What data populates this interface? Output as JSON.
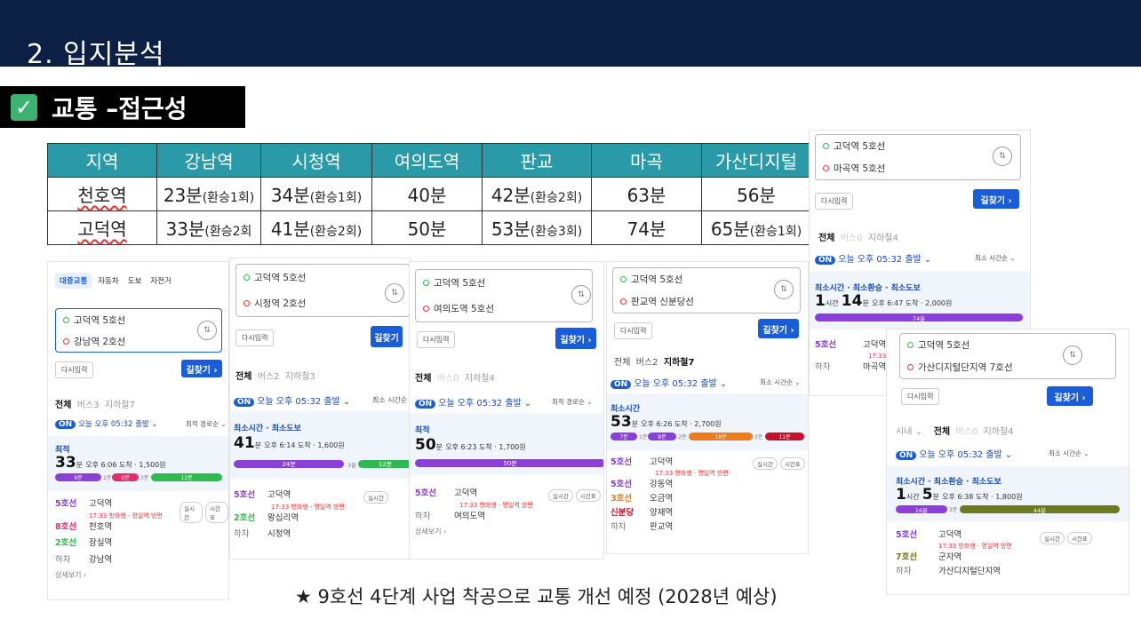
{
  "header": {
    "title": "2. 입지분석"
  },
  "section": {
    "title": "교통 –접근성"
  },
  "table": {
    "headers": [
      "지역",
      "강남역",
      "시청역",
      "여의도역",
      "판교",
      "마곡",
      "가산디지털"
    ],
    "rows": [
      {
        "area": "천호역",
        "cells": [
          [
            "23분",
            "(환승1회)"
          ],
          [
            "34분",
            "(환승1회)"
          ],
          [
            "40분",
            ""
          ],
          [
            "42분",
            "(환승2회)"
          ],
          [
            "63분",
            ""
          ],
          [
            "56분",
            ""
          ]
        ]
      },
      {
        "area": "고덕역",
        "cells": [
          [
            "33분",
            "(환승2회"
          ],
          [
            "41분",
            "(환승2회)"
          ],
          [
            "50분",
            ""
          ],
          [
            "53분",
            "(환승3회)"
          ],
          [
            "74분",
            ""
          ],
          [
            "65분",
            "(환승1회)"
          ]
        ]
      }
    ]
  },
  "shots": {
    "gangnam": {
      "modes": [
        "대중교통",
        "자동차",
        "도보",
        "자전거"
      ],
      "from": "고덕역 5호선",
      "to": "강남역 2호선",
      "reset": "다시입력",
      "search": "길찾기 ›",
      "tabs": [
        "전체",
        "버스3",
        "지하철7"
      ],
      "on_time": "오늘 오후 05:32 출발 ⌄",
      "sort": "최적 경로순 ⌄",
      "label": "최적",
      "time": "33",
      "time_unit": "분",
      "arrive": "오후 6:06 도착 · 1,500원",
      "segments": [
        "9분",
        "1분",
        "8분",
        "3분",
        "12분"
      ],
      "steps": [
        [
          "5호선",
          "고덕역"
        ],
        [
          "",
          "17:33 방화행 · 명일역 방면"
        ],
        [
          "8호선",
          "천호역"
        ],
        [
          "2호선",
          "잠실역"
        ],
        [
          "하차",
          "강남역"
        ]
      ],
      "more": "상세보기 ›"
    },
    "city": {
      "from": "고덕역 5호선",
      "to": "시청역 2호선",
      "reset": "다시입력",
      "search": "길찾기",
      "tabs": [
        "전체",
        "버스2",
        "지하철3"
      ],
      "on_time": "오늘 오후 05:32 출발 ⌄",
      "sort": "최소 시간순",
      "label": "최소시간 · 최소도보",
      "time": "41",
      "time_unit": "분",
      "arrive": "오후 6:14 도착 · 1,600원",
      "segments": [
        "24분",
        "3분",
        "12분"
      ],
      "steps": [
        [
          "5호선",
          "고덕역"
        ],
        [
          "",
          "17:33 방화행 · 명일역 방면"
        ],
        [
          "2호선",
          "왕십리역"
        ],
        [
          "하차",
          "시청역"
        ]
      ]
    },
    "yeouido": {
      "from": "고덕역 5호선",
      "to": "여의도역 5호선",
      "reset": "다시입력",
      "search": "길찾기 ›",
      "tabs": [
        "전체",
        "버스0",
        "지하철4"
      ],
      "on_time": "오늘 오후 05:32 출발 ⌄",
      "sort": "최적 경로순 ⌄",
      "label": "최적",
      "time": "50",
      "time_unit": "분",
      "arrive": "오후 6:23 도착 · 1,700원",
      "segments": [
        "50분"
      ],
      "steps": [
        [
          "5호선",
          "고덕역"
        ],
        [
          "",
          "17:33 방화행 · 명일역 방면"
        ],
        [
          "하차",
          "여의도역"
        ]
      ],
      "more": "상세보기 ›"
    },
    "pangyo": {
      "from": "고덕역 5호선",
      "to": "판교역 신분당선",
      "reset": "다시입력",
      "search": "길찾기 ›",
      "tabs": [
        "전체",
        "버스2",
        "지하철7"
      ],
      "on_time": "오늘 오후 05:32 출발 ⌄",
      "sort": "최소 시간순 ⌄",
      "label": "최소시간",
      "time": "53",
      "time_unit": "분",
      "arrive": "오후 6:26 도착 · 2,700원",
      "segments": [
        "7분",
        "1분",
        "8분",
        "2분",
        "19분",
        "3분",
        "11분"
      ],
      "steps": [
        [
          "5호선",
          "고덕역"
        ],
        [
          "",
          "17:33 방화행 · 명일역 방면"
        ],
        [
          "5호선",
          "강동역"
        ],
        [
          "3호선",
          "오금역"
        ],
        [
          "신분당",
          "양재역"
        ],
        [
          "하차",
          "판교역"
        ]
      ]
    },
    "magok": {
      "from": "고덕역 5호선",
      "to": "마곡역 5호선",
      "reset": "다시입력",
      "search": "길찾기 ›",
      "tabs": [
        "전체",
        "버스0",
        "지하철4"
      ],
      "on_time": "오늘 오후 05:32 출발 ⌄",
      "sort": "최소 시간순 ⌄",
      "label": "최소시간 · 최소환승 · 최소도보",
      "time": "1",
      "time_unit": "시간",
      "time2": "14",
      "time2_unit": "분",
      "arrive": "오후 6:47 도착 · 2,000원",
      "segments": [
        "74분"
      ],
      "steps": [
        [
          "5호선",
          "고덕역"
        ],
        [
          "",
          "17:33 방"
        ],
        [
          "하차",
          "마곡역"
        ]
      ]
    },
    "gasan": {
      "from": "고덕역 5호선",
      "to": "가산디지털단지역 7호선",
      "reset": "다시입력",
      "search": "길찾기 ›",
      "tabs": [
        "시내 ⌄",
        "전체",
        "버스0",
        "지하철4"
      ],
      "on_time": "오늘 오후 05:32 출발 ⌄",
      "sort": "최소 시간순 ⌄",
      "label": "최소시간 · 최소환승 · 최소도보",
      "time": "1",
      "time_unit": "시간",
      "time2": "5",
      "time2_unit": "분",
      "arrive": "오후 6:38 도착 · 1,800원",
      "segments": [
        "16분",
        "3분",
        "44분"
      ],
      "steps": [
        [
          "5호선",
          "고덕역"
        ],
        [
          "",
          "17:33 방화행 · 명일역 방면"
        ],
        [
          "7호선",
          "군자역"
        ],
        [
          "하차",
          "가산디지털단지역"
        ]
      ]
    },
    "realtime": "실시간",
    "timetable": "시간표"
  },
  "note": "★ 9호선 4단계 사업 착공으로 교통 개선 예정 (2028년 예상)",
  "colors": {
    "header_bg": "#0c1f44",
    "table_head": "#2a9aa8",
    "line5": "#8b3fd9",
    "line8": "#e0306a",
    "line2": "#2dba4e",
    "line3": "#ef7c1c",
    "shinbundang": "#c8102e",
    "line7": "#6b7a1f",
    "accent": "#1a5dd8"
  }
}
